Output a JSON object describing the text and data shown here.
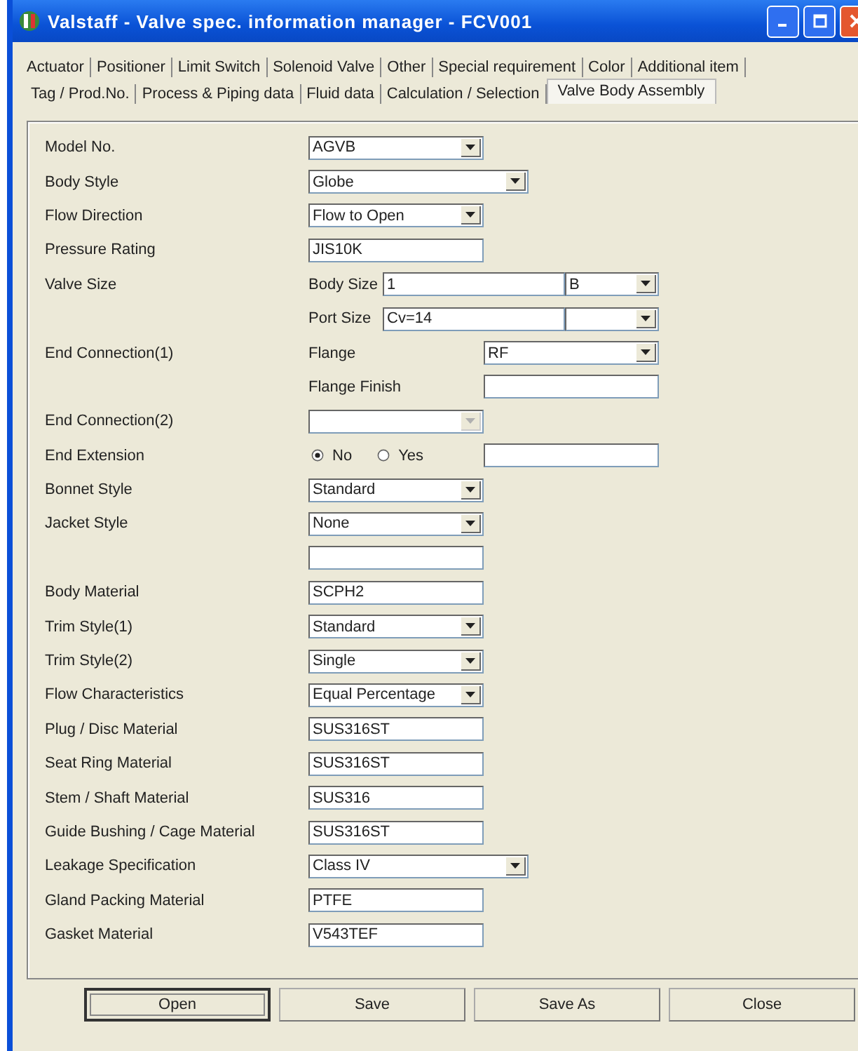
{
  "window": {
    "title": "Valstaff - Valve spec. information manager - FCV001"
  },
  "tab_rows": [
    [
      {
        "label": "Actuator",
        "selected": false
      },
      {
        "label": "Positioner",
        "selected": false
      },
      {
        "label": "Limit Switch",
        "selected": false
      },
      {
        "label": "Solenoid Valve",
        "selected": false
      },
      {
        "label": "Other",
        "selected": false
      },
      {
        "label": "Special requirement",
        "selected": false
      },
      {
        "label": "Color",
        "selected": false
      },
      {
        "label": "Additional item",
        "selected": false
      }
    ],
    [
      {
        "label": "Tag / Prod.No.",
        "selected": false
      },
      {
        "label": "Process & Piping data",
        "selected": false
      },
      {
        "label": "Fluid data",
        "selected": false
      },
      {
        "label": "Calculation / Selection",
        "selected": false
      },
      {
        "label": "Valve Body Assembly",
        "selected": true
      }
    ]
  ],
  "form": [
    {
      "kind": "combo",
      "label": "Model No.",
      "value": "AGVB"
    },
    {
      "kind": "combo-wide",
      "label": "Body Style",
      "value": "Globe"
    },
    {
      "kind": "combo",
      "label": "Flow Direction",
      "value": "Flow to Open"
    },
    {
      "kind": "text",
      "label": "Pressure Rating",
      "value": "JIS10K"
    },
    {
      "kind": "size",
      "label": "Valve Size",
      "sub_label": "Body Size",
      "value": "1",
      "unit": "B"
    },
    {
      "kind": "size",
      "sub_label": "Port Size",
      "value": "Cv=14"
    },
    {
      "kind": "sub-combo",
      "label": "End Connection(1)",
      "sub_label": "Flange",
      "value": "RF"
    },
    {
      "kind": "sub-text",
      "sub_label": "Flange Finish"
    },
    {
      "kind": "combo",
      "label": "End Connection(2)",
      "disabled": true
    },
    {
      "kind": "radio",
      "label": "End Extension",
      "options": [
        {
          "label": "No",
          "selected": true
        },
        {
          "label": "Yes",
          "selected": false
        }
      ]
    },
    {
      "kind": "combo",
      "label": "Bonnet Style",
      "value": "Standard"
    },
    {
      "kind": "combo",
      "label": "Jacket Style",
      "value": "None"
    },
    {
      "kind": "text"
    },
    {
      "kind": "text",
      "label": "Body Material",
      "value": "SCPH2"
    },
    {
      "kind": "combo",
      "label": "Trim Style(1)",
      "value": "Standard"
    },
    {
      "kind": "combo",
      "label": "Trim Style(2)",
      "value": "Single"
    },
    {
      "kind": "combo",
      "label": "Flow Characteristics",
      "value": "Equal Percentage"
    },
    {
      "kind": "text",
      "label": "Plug / Disc Material",
      "value": "SUS316ST"
    },
    {
      "kind": "text",
      "label": "Seat Ring Material",
      "value": "SUS316ST"
    },
    {
      "kind": "text",
      "label": "Stem / Shaft Material",
      "value": "SUS316"
    },
    {
      "kind": "text",
      "label": "Guide Bushing / Cage Material",
      "value": "SUS316ST"
    },
    {
      "kind": "combo-wide",
      "label": "Leakage Specification",
      "value": "Class IV"
    },
    {
      "kind": "text",
      "label": "Gland Packing Material",
      "value": "PTFE"
    },
    {
      "kind": "text",
      "label": "Gasket Material",
      "value": "V543TEF"
    }
  ],
  "buttons": [
    {
      "label": "Open",
      "default": true
    },
    {
      "label": "Save",
      "default": false
    },
    {
      "label": "Save As",
      "default": false
    },
    {
      "label": "Close",
      "default": false
    }
  ]
}
